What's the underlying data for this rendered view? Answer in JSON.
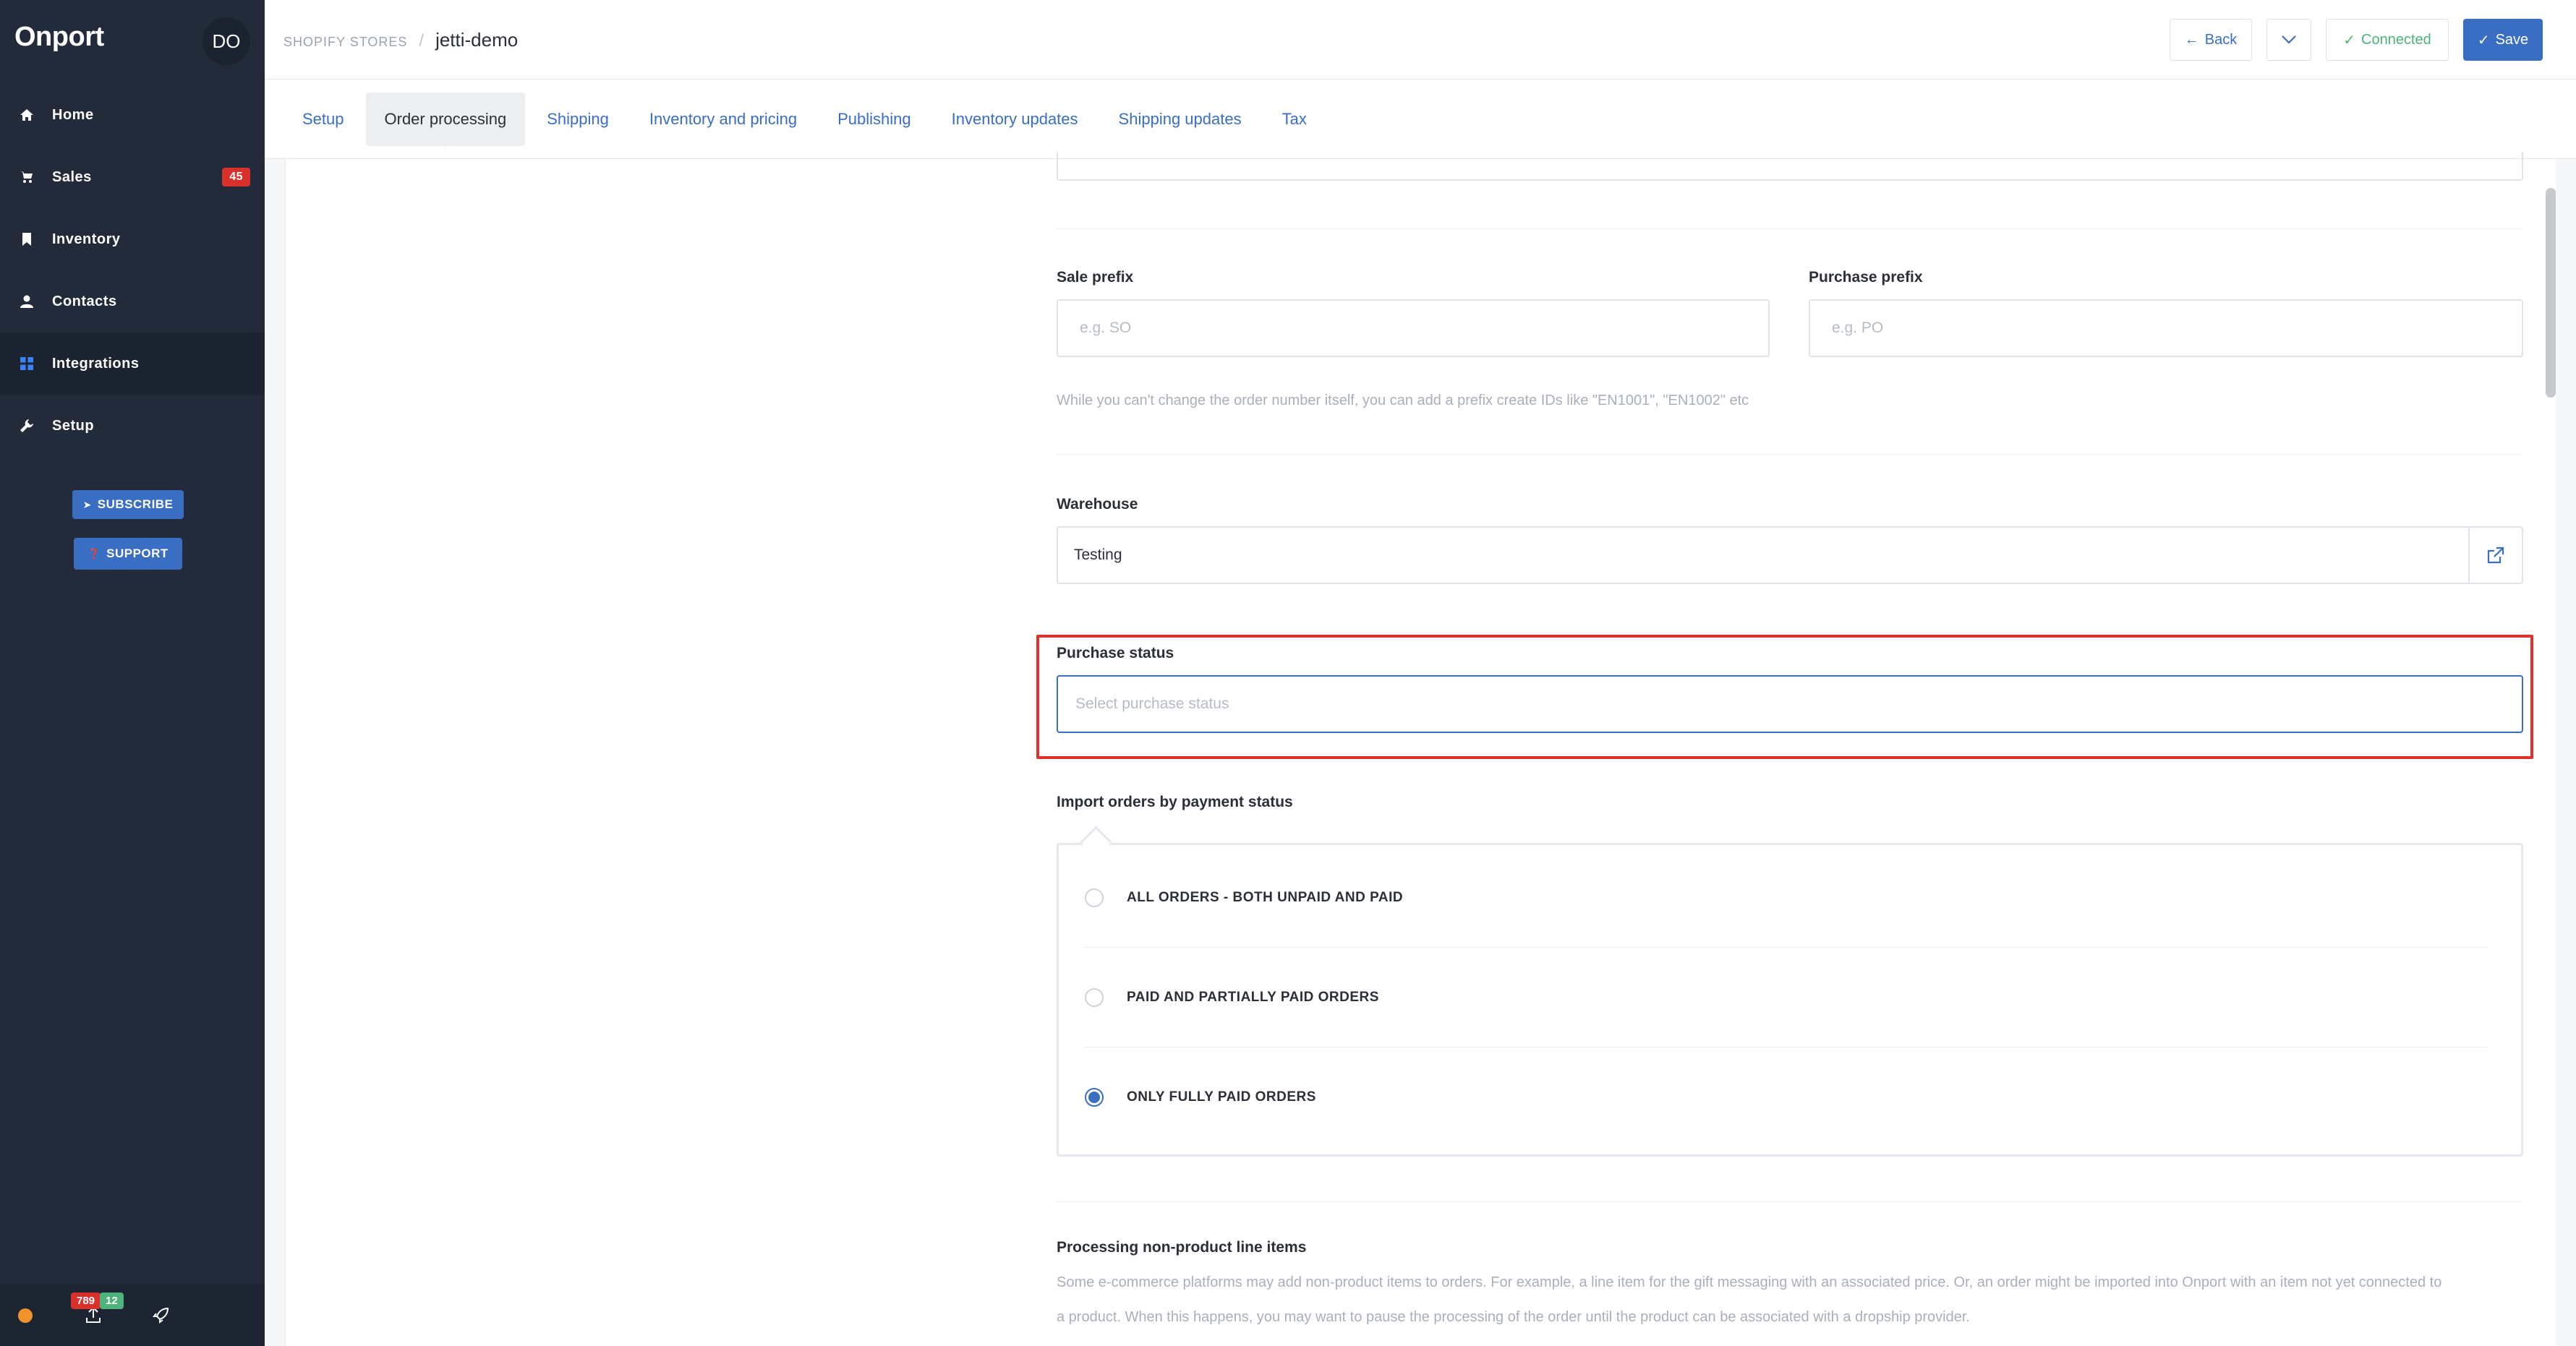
{
  "sidebar": {
    "brand": "Onport",
    "avatar": "DO",
    "items": [
      {
        "label": "Home",
        "icon": "home-icon"
      },
      {
        "label": "Sales",
        "icon": "cart-icon",
        "badge": "45"
      },
      {
        "label": "Inventory",
        "icon": "bookmark-icon"
      },
      {
        "label": "Contacts",
        "icon": "user-icon"
      },
      {
        "label": "Integrations",
        "icon": "grid-icon",
        "active": true
      },
      {
        "label": "Setup",
        "icon": "wrench-icon"
      }
    ],
    "subscribe_label": "SUBSCRIBE",
    "support_label": "SUPPORT",
    "footer": {
      "badge_red": "789",
      "badge_green": "12"
    }
  },
  "header": {
    "store_type": "SHOPIFY STORES",
    "separator": "/",
    "store_name": "jetti-demo",
    "back_label": "Back",
    "connected_label": "Connected",
    "save_label": "Save"
  },
  "tabs": [
    {
      "label": "Setup"
    },
    {
      "label": "Order processing",
      "active": true
    },
    {
      "label": "Shipping"
    },
    {
      "label": "Inventory and pricing"
    },
    {
      "label": "Publishing"
    },
    {
      "label": "Inventory updates"
    },
    {
      "label": "Shipping updates"
    },
    {
      "label": "Tax"
    }
  ],
  "form": {
    "sale_prefix": {
      "label": "Sale prefix",
      "placeholder": "e.g. SO"
    },
    "purchase_prefix": {
      "label": "Purchase prefix",
      "placeholder": "e.g. PO"
    },
    "prefix_hint": "While you can't change the order number itself, you can add a prefix create IDs like \"EN1001\", \"EN1002\" etc",
    "warehouse": {
      "label": "Warehouse",
      "value": "Testing"
    },
    "purchase_status": {
      "label": "Purchase status",
      "placeholder": "Select purchase status"
    },
    "import_orders": {
      "label": "Import orders by payment status",
      "options": [
        {
          "label": "ALL ORDERS - BOTH UNPAID AND PAID",
          "checked": false
        },
        {
          "label": "PAID AND PARTIALLY PAID ORDERS",
          "checked": false
        },
        {
          "label": "ONLY FULLY PAID ORDERS",
          "checked": true
        }
      ]
    },
    "non_product": {
      "label": "Processing non-product line items",
      "description_1": "Some e-commerce platforms may add non-product items to orders. For example, a line item for the gift messaging with an associated price. Or, an order might be imported into Onport with an item not yet connected to",
      "description_2": "a product. When this happens, you may want to pause the processing of the order until the product can be associated with a dropship provider."
    }
  },
  "colors": {
    "accent": "#3a6ec2",
    "sidebar": "#232b3a",
    "highlight": "#e0322b",
    "badge_red": "#d9302c",
    "badge_green": "#4cb37a"
  }
}
